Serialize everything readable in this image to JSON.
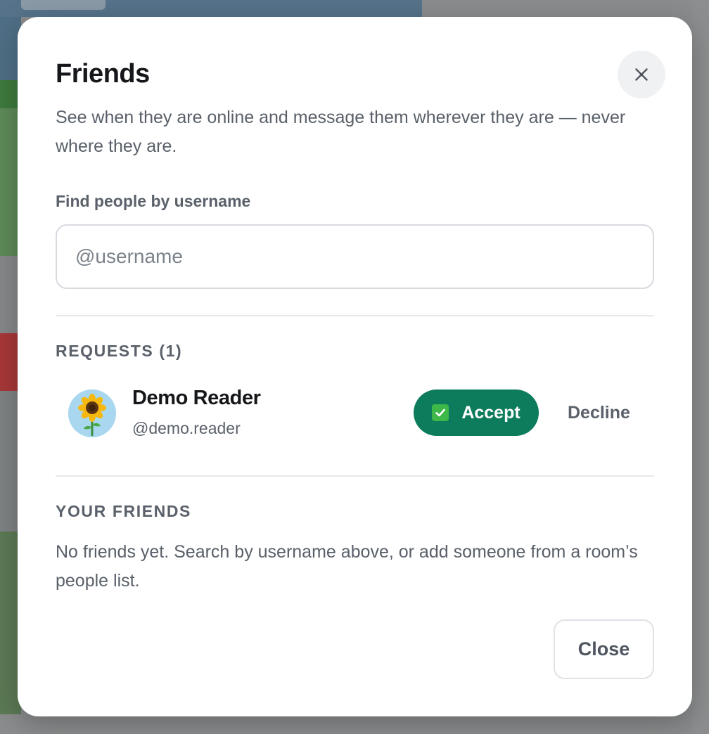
{
  "dialog": {
    "title": "Friends",
    "subtitle": "See when they are online and message them wherever they are — never where they are.",
    "close_icon": "close-icon"
  },
  "search": {
    "label": "Find people by username",
    "placeholder": "@username",
    "value": ""
  },
  "requests": {
    "heading": "REQUESTS (1)",
    "items": [
      {
        "avatar": "sunflower-avatar",
        "name": "Demo Reader",
        "handle": "@demo.reader",
        "accept_label": "Accept",
        "accept_icon": "check-icon",
        "decline_label": "Decline"
      }
    ]
  },
  "friends": {
    "heading": "YOUR FRIENDS",
    "empty_text": "No friends yet. Search by username above, or add someone from a room’s people list."
  },
  "footer": {
    "close_label": "Close"
  },
  "colors": {
    "accent": "#0d7c5c",
    "avatar_bg": "#a9d7ef",
    "check_green": "#3fb84a"
  }
}
